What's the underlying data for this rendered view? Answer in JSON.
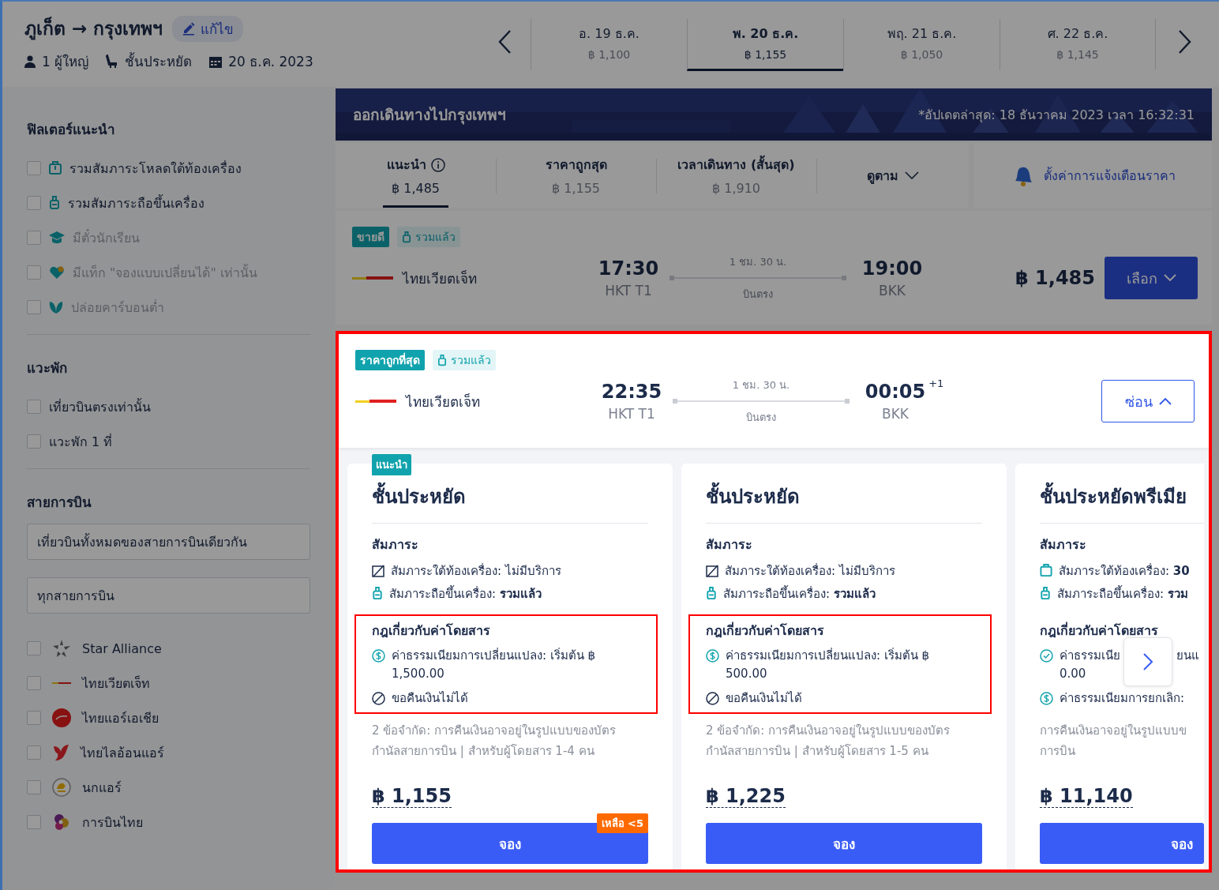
{
  "header": {
    "route": "ภูเก็ต → กรุงเทพฯ",
    "edit": "แก้ไข",
    "passengers": "1 ผู้ใหญ่",
    "cabin": "ชั้นประหยัด",
    "date": "20 ธ.ค. 2023"
  },
  "date_tabs": [
    {
      "day": "อ. 19 ธ.ค.",
      "price": "฿ 1,100",
      "selected": false
    },
    {
      "day": "พ. 20 ธ.ค.",
      "price": "฿ 1,155",
      "selected": true
    },
    {
      "day": "พฤ. 21 ธ.ค.",
      "price": "฿ 1,050",
      "selected": false
    },
    {
      "day": "ศ. 22 ธ.ค.",
      "price": "฿ 1,145",
      "selected": false
    }
  ],
  "sidebar": {
    "sections": [
      {
        "title": "ฟิลเตอร์แนะนำ",
        "items": [
          {
            "label": "รวมสัมภาระโหลดใต้ท้องเครื่อง",
            "kind": "checked-bag",
            "checked": false,
            "disabled": false
          },
          {
            "label": "รวมสัมภาระถือขึ้นเครื่อง",
            "kind": "carry-on",
            "checked": false,
            "disabled": false
          },
          {
            "label": "มีตั๋วนักเรียน",
            "kind": "cap",
            "checked": false,
            "disabled": true
          },
          {
            "label": "มีแท็ก \"จองแบบเปลี่ยนได้\" เท่านั้น",
            "kind": "heart",
            "checked": false,
            "disabled": true
          },
          {
            "label": "ปล่อยคาร์บอนต่ำ",
            "kind": "leaf",
            "checked": false,
            "disabled": true
          }
        ]
      },
      {
        "title": "แวะพัก",
        "items": [
          {
            "label": "เที่ยวบินตรงเท่านั้น",
            "checked": false,
            "disabled": false
          },
          {
            "label": "แวะพัก 1 ที่",
            "checked": false,
            "disabled": false
          }
        ]
      },
      {
        "title": "สายการบิน",
        "selects": [
          "เที่ยวบินทั้งหมดของสายการบินเดียวกัน",
          "ทุกสายการบิน"
        ],
        "items": [
          {
            "label": "Star Alliance",
            "kind": "star",
            "checked": false,
            "disabled": false
          },
          {
            "label": "ไทยเวียตเจ็ท",
            "kind": "stripe",
            "checked": false,
            "disabled": false
          },
          {
            "label": "ไทยแอร์เอเชีย",
            "kind": "red-circle",
            "checked": false,
            "disabled": false
          },
          {
            "label": "ไทยไลอ้อนแอร์",
            "kind": "red-bird",
            "checked": false,
            "disabled": false
          },
          {
            "label": "นกแอร์",
            "kind": "yellow-circle",
            "checked": false,
            "disabled": false
          },
          {
            "label": "การบินไทย",
            "kind": "purple-flower",
            "checked": false,
            "disabled": false
          }
        ]
      }
    ]
  },
  "results": {
    "banner": {
      "title": "ออกเดินทางไปกรุงเทพฯ",
      "updated": "*อัปเดตล่าสุด: 18 ธันวาคม 2023 เวลา 16:32:31"
    },
    "sort_tabs": [
      {
        "label": "แนะนำ",
        "price": "฿ 1,485",
        "info": true,
        "selected": true
      },
      {
        "label": "ราคาถูกสุด",
        "price": "฿ 1,155",
        "info": false,
        "selected": false
      },
      {
        "label": "เวลาเดินทาง (สั้นสุด)",
        "price": "฿ 1,910",
        "info": false,
        "selected": false
      }
    ],
    "sort_menu": "ดูตาม",
    "price_alert": "ตั้งค่าการแจ้งเตือนราคา",
    "flights": [
      {
        "tags": [
          {
            "kind": "solid",
            "text": "ขายดี"
          },
          {
            "kind": "bag",
            "text": "รวมแล้ว"
          }
        ],
        "airline": "ไทยเวียตเจ็ท",
        "depart_time": "17:30",
        "depart_airport": "HKT T1",
        "duration": "1 ชม. 30 น.",
        "stops": "บินตรง",
        "arrive_time": "19:00",
        "arrive_airport": "BKK",
        "price": "฿ 1,485",
        "button": "เลือก",
        "expanded": false,
        "highlighted": false
      },
      {
        "tags": [
          {
            "kind": "solid",
            "text": "ราคาถูกที่สุด"
          },
          {
            "kind": "bag",
            "text": "รวมแล้ว"
          }
        ],
        "airline": "ไทยเวียตเจ็ท",
        "depart_time": "22:35",
        "depart_airport": "HKT T1",
        "duration": "1 ชม. 30 น.",
        "stops": "บินตรง",
        "arrive_time": "00:05",
        "day_offset": "+1",
        "arrive_airport": "BKK",
        "button": "ซ่อน",
        "expanded": true,
        "highlighted": true,
        "fares": [
          {
            "kind": "full",
            "badge": "แนะนำ",
            "title": "ชั้นประหยัด",
            "baggage_heading": "สัมภาระ",
            "baggage": [
              {
                "kind": "none",
                "text": "สัมภาระใต้ท้องเครื่อง: ไม่มีบริการ"
              },
              {
                "kind": "carry",
                "text": "สัมภาระถือขึ้นเครื่อง: **รวมแล้ว**"
              }
            ],
            "rules_heading": "กฎเกี่ยวกับค่าโดยสาร",
            "annotated": true,
            "rules": [
              {
                "kind": "fee",
                "lines": [
                  "ค่าธรรมเนียมการเปลี่ยนแปลง: เริ่มต้น ฿",
                  "1,500.00"
                ]
              },
              {
                "kind": "no-refund",
                "lines": [
                  "ขอคืนเงินไม่ได้"
                ]
              }
            ],
            "restrictions": [
              "2 ข้อจำกัด: การคืนเงินอาจอยู่ในรูปแบบของบัตร",
              "กำนัลสายการบิน | สำหรับผู้โดยสาร 1-4 คน"
            ],
            "price": "฿ 1,155",
            "remaining": "เหลือ <5",
            "book": "จอง"
          },
          {
            "kind": "full",
            "title": "ชั้นประหยัด",
            "baggage_heading": "สัมภาระ",
            "baggage": [
              {
                "kind": "none",
                "text": "สัมภาระใต้ท้องเครื่อง: ไม่มีบริการ"
              },
              {
                "kind": "carry",
                "text": "สัมภาระถือขึ้นเครื่อง: **รวมแล้ว**"
              }
            ],
            "rules_heading": "กฎเกี่ยวกับค่าโดยสาร",
            "annotated": true,
            "rules": [
              {
                "kind": "fee",
                "lines": [
                  "ค่าธรรมเนียมการเปลี่ยนแปลง: เริ่มต้น ฿",
                  "500.00"
                ]
              },
              {
                "kind": "no-refund",
                "lines": [
                  "ขอคืนเงินไม่ได้"
                ]
              }
            ],
            "restrictions": [
              "2 ข้อจำกัด: การคืนเงินอาจอยู่ในรูปแบบของบัตร",
              "กำนัลสายการบิน | สำหรับผู้โดยสาร 1-5 คน"
            ],
            "price": "฿ 1,225",
            "book": "จอง"
          },
          {
            "kind": "partial",
            "title": "ชั้นประหยัดพรีเมีย",
            "baggage_heading": "สัมภาระ",
            "baggage": [
              {
                "kind": "checked",
                "text": "สัมภาระใต้ท้องเครื่อง: **30**"
              },
              {
                "kind": "carry",
                "text": "สัมภาระถือขึ้นเครื่อง: **รวม**"
              }
            ],
            "rules_heading": "กฎเกี่ยวกับค่าโดยสาร",
            "annotated": false,
            "rules": [
              {
                "kind": "free",
                "lines": [
                  "ค่าธรรมเนีย",
                  "0.00"
                ],
                "tail": "ยนแ"
              },
              {
                "kind": "fee",
                "lines": [
                  "ค่าธรรมเนียมการยกเลิก:"
                ]
              }
            ],
            "restrictions": [
              "การคืนเงินอาจอยู่ในรูปแบบข",
              "การบิน"
            ],
            "price": "฿ 11,140",
            "book": "จอง"
          }
        ]
      }
    ]
  }
}
